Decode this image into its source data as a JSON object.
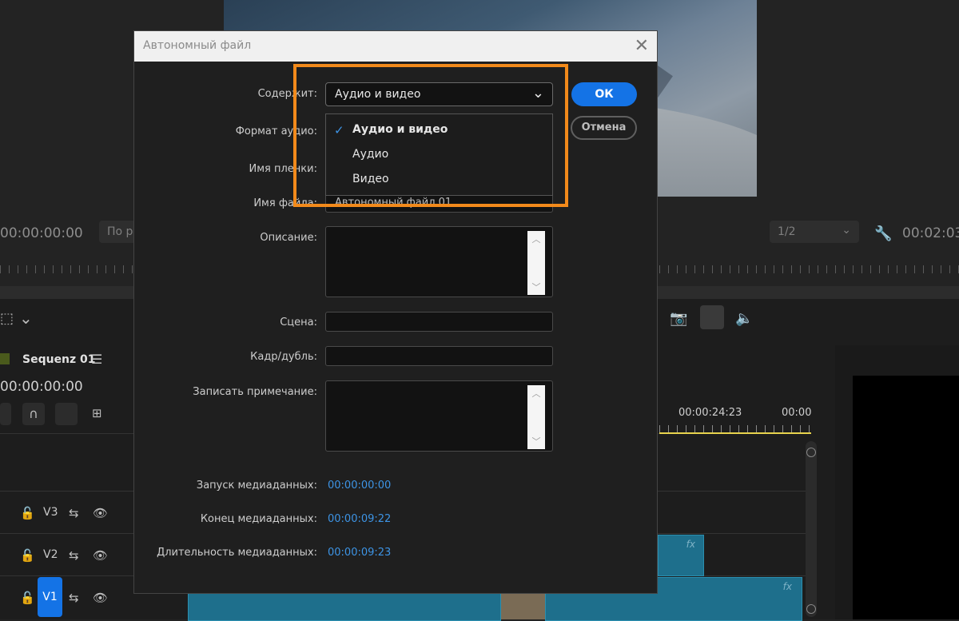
{
  "app": {
    "source_timecode": "00:00:00:00",
    "fit_label": "По р",
    "zoom_ratio": "1/2",
    "program_timecode": "00:02:03",
    "sequence_name": "Sequenz 01",
    "sequence_timecode": "00:00:00:00",
    "ruler_time_1": "00:00:24:23",
    "ruler_time_2": "00:00",
    "tracks": [
      "V3",
      "V2",
      "V1"
    ],
    "fx_label": "fx"
  },
  "dialog": {
    "title": "Автономный файл",
    "close_glyph": "✕",
    "ok_label": "ОК",
    "cancel_label": "Отмена",
    "content_label": "Содержит:",
    "content_value": "Аудио и видео",
    "audio_format_label": "Формат аудио:",
    "tape_name_label": "Имя пленки:",
    "file_name_label": "Имя файла:",
    "file_name_value": "Автономный файл 01",
    "description_label": "Описание:",
    "scene_label": "Сцена:",
    "take_label": "Кадр/дубль:",
    "log_note_label": "Записать примечание:",
    "media_start_label": "Запуск медиаданных:",
    "media_start_value": "00:00:00:00",
    "media_end_label": "Конец медиаданных:",
    "media_end_value": "00:00:09:22",
    "media_duration_label": "Длительность медиаданных:",
    "media_duration_value": "00:00:09:23",
    "dropdown_options": [
      "Аудио и видео",
      "Аудио",
      "Видео"
    ],
    "selected_option": "Аудио и видео"
  },
  "colors": {
    "accent": "#1473e6",
    "highlight": "#f28a1b",
    "timecode": "#3d94e5",
    "clip": "#1e6f8c"
  }
}
